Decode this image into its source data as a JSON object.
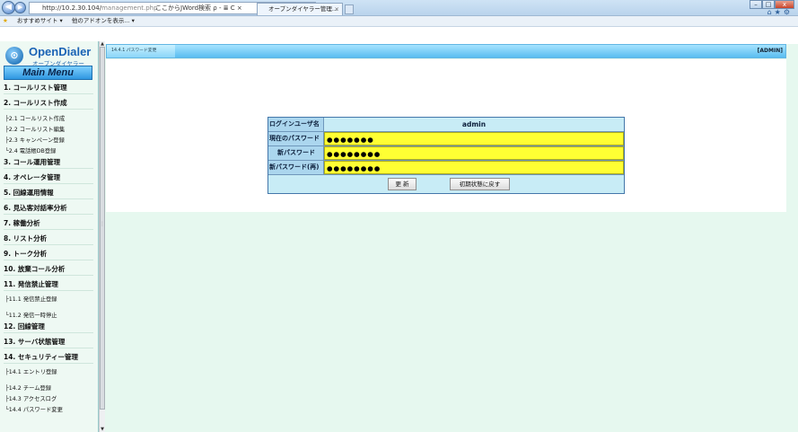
{
  "browser": {
    "address": "http://10.2.30.104/management.php",
    "address_host": "http://10.2.30.104/",
    "address_path": "management.php",
    "search_box": "ここからJWord検索",
    "search_controls": "ρ - ≣ C ×",
    "tab_title": "オープンダイヤラー管理...",
    "tab_close": "×",
    "favorites": [
      "おすすめサイト ▾",
      "他のアドオンを表示... ▾"
    ],
    "win_min": "–",
    "win_max": "□",
    "win_close": "x"
  },
  "sidebar": {
    "logo_title": "OpenDialer",
    "logo_sub": "オープンダイヤラー",
    "main_menu": "Main Menu",
    "items": [
      {
        "label": "1. コールリスト管理"
      },
      {
        "label": "2. コールリスト作成"
      },
      {
        "label": "├2.1 コールリスト作成",
        "sub": true
      },
      {
        "label": "├2.2 コールリスト編集",
        "sub": true
      },
      {
        "label": "├2.3 キャンペーン登録",
        "sub": true
      },
      {
        "label": "└2.4 電話帳DB登録",
        "sub": true
      },
      {
        "label": "3. コール運用管理"
      },
      {
        "label": "4. オペレータ管理"
      },
      {
        "label": "5. 回線運用情報"
      },
      {
        "label": "6. 見込客対話率分析"
      },
      {
        "label": "7. 稼働分析"
      },
      {
        "label": "8. リスト分析"
      },
      {
        "label": "9. トーク分析"
      },
      {
        "label": "10. 放棄コール分析"
      },
      {
        "label": "11. 発信禁止管理"
      },
      {
        "label": "├11.1 発信禁止登録",
        "sub": true
      },
      {
        "label": "└11.2 発信一時停止",
        "sub": true
      },
      {
        "label": "12. 回線管理"
      },
      {
        "label": "13. サーバ状態管理"
      },
      {
        "label": "14. セキュリティー管理"
      },
      {
        "label": "├14.1 エントリ登録",
        "sub": true
      },
      {
        "label": "├14.2 チーム登録",
        "sub": true
      },
      {
        "label": "├14.3 アクセスログ",
        "sub": true
      },
      {
        "label": "└14.4 パスワード変更",
        "sub": true
      }
    ]
  },
  "header": {
    "breadcrumb": "14.4.1 パスワード変更",
    "role": "[ADMIN]"
  },
  "form": {
    "user_label": "ログインユーザ名",
    "user_value": "admin",
    "current_pw_label": "現在のパスワード",
    "current_pw_value": "●●●●●●●",
    "new_pw_label": "新パスワード",
    "new_pw_value": "●●●●●●●●",
    "confirm_pw_label": "新パスワード(再)",
    "confirm_pw_value": "●●●●●●●●",
    "update_button": "更 新",
    "reset_button": "初期状態に戻す"
  }
}
